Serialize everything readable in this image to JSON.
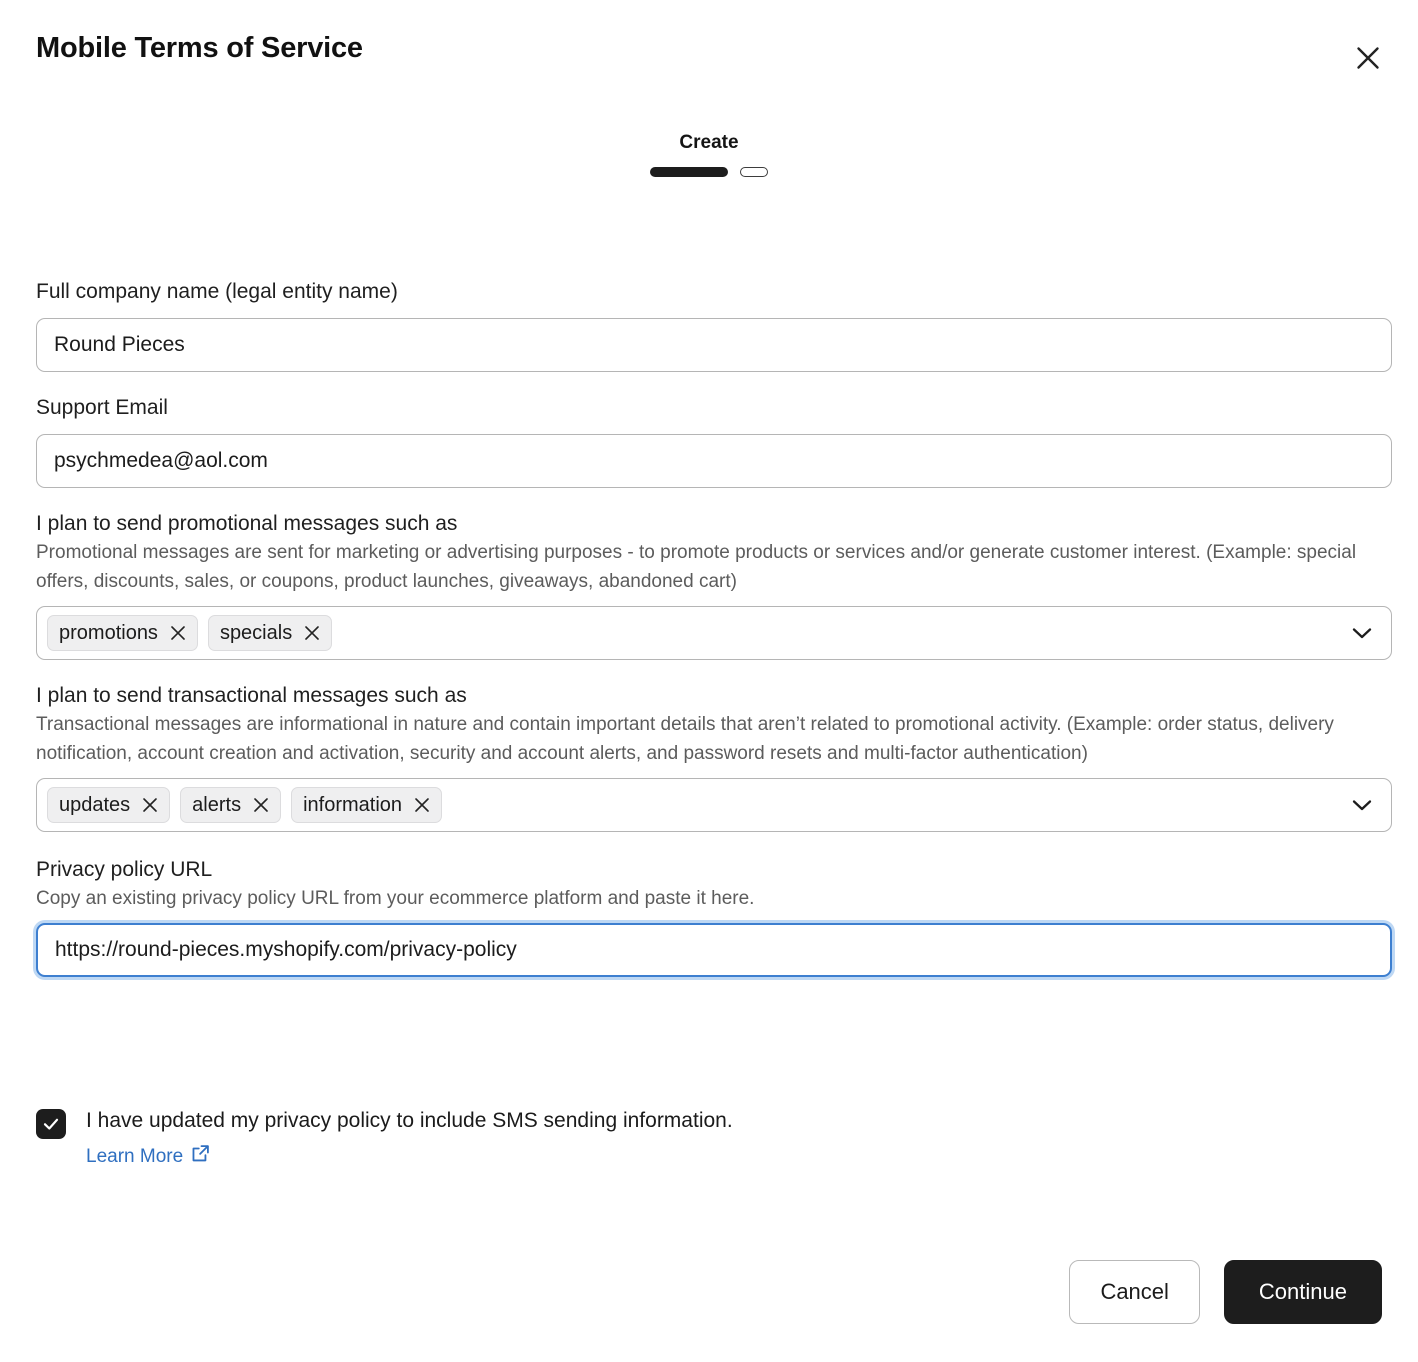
{
  "modal": {
    "title": "Mobile Terms of Service",
    "close_icon": "close-icon"
  },
  "stepper": {
    "label": "Create",
    "current_step": 1,
    "total_steps": 2
  },
  "form": {
    "company": {
      "label": "Full company name (legal entity name)",
      "value": "Round Pieces",
      "placeholder": ""
    },
    "support_email": {
      "label": "Support Email",
      "value": "psychmedea@aol.com",
      "placeholder": ""
    },
    "promotional": {
      "label": "I plan to send promotional messages such as",
      "help": "Promotional messages are sent for marketing or advertising purposes - to promote products or services and/or generate customer interest. (Example: special offers, discounts, sales, or coupons, product launches, giveaways, abandoned cart)",
      "tags": [
        "promotions",
        "specials"
      ],
      "chevron_icon": "chevron-down-icon"
    },
    "transactional": {
      "label": "I plan to send transactional messages such as",
      "help": "Transactional messages are informational in nature and contain important details that aren’t related to promotional activity. (Example: order status, delivery notification, account creation and activation, security and account alerts, and password resets and multi-factor authentication)",
      "tags": [
        "updates",
        "alerts",
        "information"
      ],
      "chevron_icon": "chevron-down-icon"
    },
    "privacy_url": {
      "label": "Privacy policy URL",
      "help": "Copy an existing privacy policy URL from your ecommerce platform and paste it here.",
      "value": "https://round-pieces.myshopify.com/privacy-policy",
      "placeholder": "",
      "focused": true
    },
    "privacy_consent": {
      "checked": true,
      "label": "I have updated my privacy policy to include SMS sending information.",
      "learn_more_label": "Learn More",
      "learn_more_icon": "external-link-icon"
    }
  },
  "footer": {
    "cancel_label": "Cancel",
    "continue_label": "Continue"
  },
  "colors": {
    "accent_dark": "#1d1d1d",
    "link_blue": "#2f6fc0",
    "focus_blue": "#3d7fd0",
    "chip_bg": "#efeff0",
    "border_gray": "#b5b5b5",
    "help_text": "#5c5c5c"
  }
}
